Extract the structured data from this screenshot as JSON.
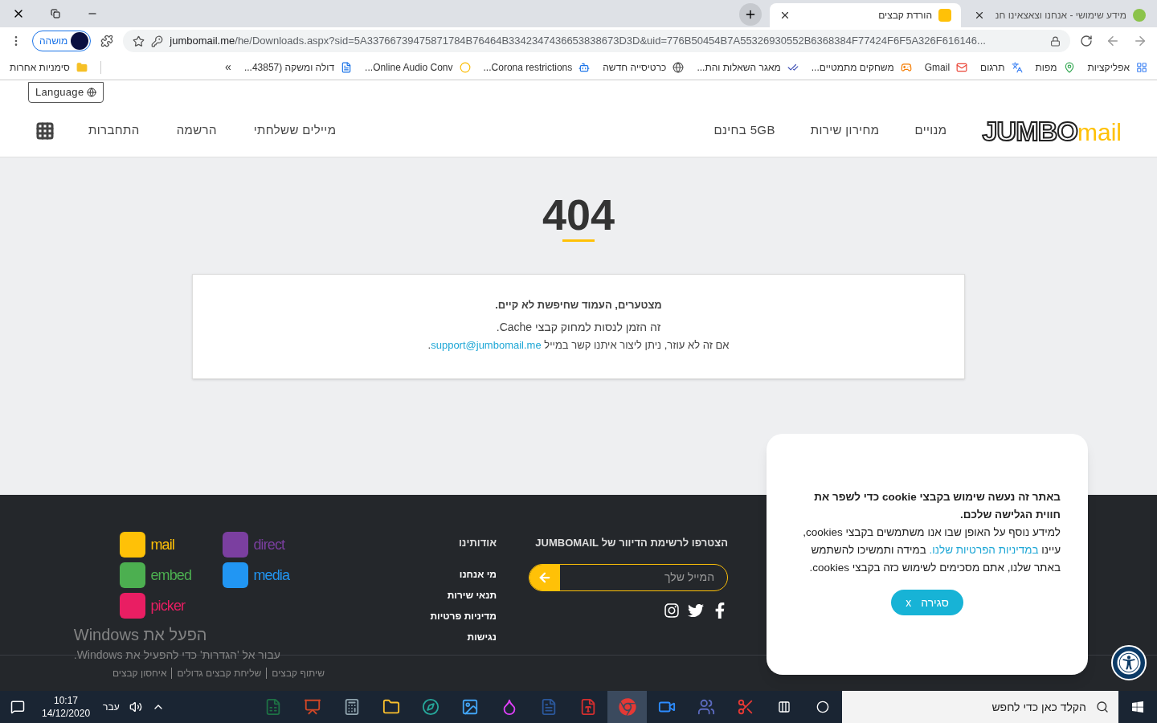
{
  "tabs": [
    {
      "title": "מידע שימושי - אנחנו וצאצאינו חנ",
      "selected": false
    },
    {
      "title": "הורדת קבצים",
      "selected": true
    }
  ],
  "toolbar": {
    "profile": "מושהה",
    "url_host": "jumbomail.me",
    "url_path": "/he/Downloads.aspx?sid=5A33766739475871784B76464B3342347436653838673D3D&uid=776B50454B7A55326930552B6368384F77424F6F5A326F616146..."
  },
  "bookmarks": [
    {
      "label": "אפליקציות"
    },
    {
      "label": "מפות"
    },
    {
      "label": "תרגום"
    },
    {
      "label": "Gmail"
    },
    {
      "label": "משחקים מתמטיים..."
    },
    {
      "label": "מאגר השאלות והת..."
    },
    {
      "label": "כרטיסייה חדשה"
    },
    {
      "label": "Corona restrictions..."
    },
    {
      "label": "Online Audio Conv..."
    },
    {
      "label": "דולה ומשקה (43857..."
    }
  ],
  "bookmarks_overflow": "»",
  "other_bookmarks": "סימניות אחרות",
  "header": {
    "language": "Language",
    "logo": {
      "word": "JUMBO",
      "suffix": "mail"
    },
    "nav_right": [
      "מנויים",
      "מחירון שירות",
      "5GB בחינם"
    ],
    "nav_left": [
      "מיילים ששלחתי",
      "הרשמה",
      "התחברות"
    ]
  },
  "error": {
    "code": "404",
    "title": "מצטערים, העמוד שחיפשת לא קיים.",
    "line": "זה הזמן לנסות למחוק קבצי Cache.",
    "contact_prefix": "אם זה לא עוזר, ניתן ליצור איתנו קשר במייל ",
    "email": "support@jumbomail.me",
    "contact_suffix": "."
  },
  "footer": {
    "newsletter_title": "הצטרפו לרשימת הדיוור של JUMBOMAIL",
    "email_placeholder": "המייל שלך",
    "about_title": "אודותינו",
    "about_links": [
      "מי אנחנו",
      "תנאי שירות",
      "מדיניות פרטיות",
      "נגישות"
    ],
    "apps": [
      {
        "name": "direct",
        "color": "#7b3fa0"
      },
      {
        "name": "media",
        "color": "#2196f3"
      },
      {
        "name": "mail",
        "color": "#ffc107"
      },
      {
        "name": "embed",
        "color": "#4caf50"
      },
      {
        "name": "picker",
        "color": "#e91e63"
      }
    ],
    "bottom_links": [
      "שיתוף קבצים",
      "שליחת קבצים גדולים",
      "איחסון קבצים"
    ]
  },
  "cookie_notice": {
    "title": "באתר זה נעשה שימוש בקבצי cookie כדי לשפר את חווית הגלישה שלכם.",
    "body_before": "למידע נוסף על האופן שבו אנו משתמשים בקבצי cookies, עיינו ",
    "link": "במדיניות הפרטיות שלנו.",
    "body_after": " במידה ותמשיכו להשתמש באתר שלנו, אתם מסכימים לשימוש כזה בקבצי cookies.",
    "close_label": "סגירה",
    "close_mark": "x"
  },
  "activation_notice": {
    "title": "הפעל את Windows",
    "body": "עבור אל 'הגדרות' כדי להפעיל את Windows."
  },
  "taskbar": {
    "search_placeholder": "הקלד כאן כדי לחפש",
    "apps": [
      {
        "kind": "snip",
        "selected": false
      },
      {
        "kind": "teams",
        "selected": false
      },
      {
        "kind": "zoom",
        "selected": false
      },
      {
        "kind": "chrome",
        "selected": true
      },
      {
        "kind": "pdf",
        "selected": false
      },
      {
        "kind": "word",
        "selected": false
      },
      {
        "kind": "paint",
        "selected": false
      },
      {
        "kind": "photos",
        "selected": false
      },
      {
        "kind": "edge",
        "selected": false
      },
      {
        "kind": "explorer",
        "selected": false
      },
      {
        "kind": "calculator",
        "selected": false
      },
      {
        "kind": "powerpoint",
        "selected": false
      },
      {
        "kind": "excel",
        "selected": false
      }
    ],
    "language": "עבר",
    "time": "10:17",
    "date": "14/12/2020"
  }
}
